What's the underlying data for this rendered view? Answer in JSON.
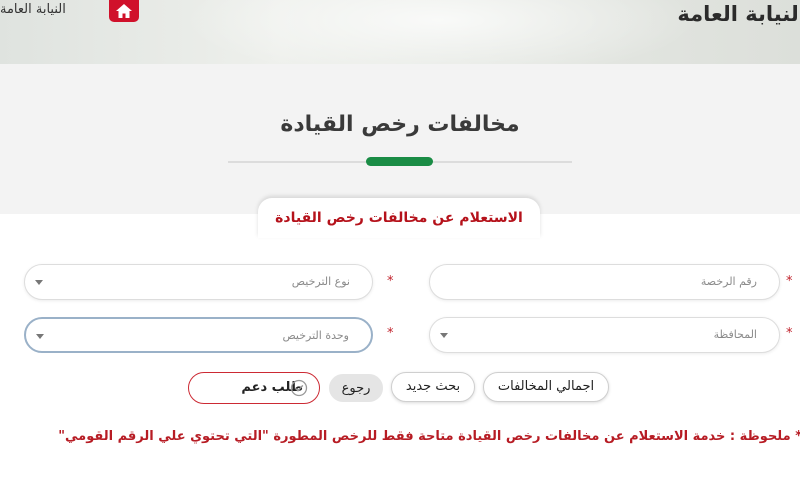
{
  "header": {
    "brand_text": "النيابة العامة",
    "home_link": "النيابة العامة",
    "home_icon": "home-icon",
    "accent": "#d0112b"
  },
  "page": {
    "title": "مخالفات رخص القيادة",
    "title_accent": "#1a8c45"
  },
  "tab": {
    "label": "الاستعلام عن مخالفات رخص القيادة"
  },
  "form": {
    "license_number_placeholder": "رقم الرخصة",
    "license_type_placeholder": "نوع الترخيص",
    "governorate_placeholder": "المحافظة",
    "licensing_unit_placeholder": "وحدة الترخيص",
    "required_marker": "*"
  },
  "buttons": {
    "total_violations": "اجمالي المخالفات",
    "new_search": "بحث جديد",
    "back": "رجوع",
    "support_request": "طلب دعم",
    "support_icon": "check-circle-icon"
  },
  "note": {
    "text": "* ملحوظة : خدمة الاستعلام عن مخالفات رخص القيادة متاحة فقط للرخص المطورة \"التي تحتوي علي الرقم القومي\""
  }
}
